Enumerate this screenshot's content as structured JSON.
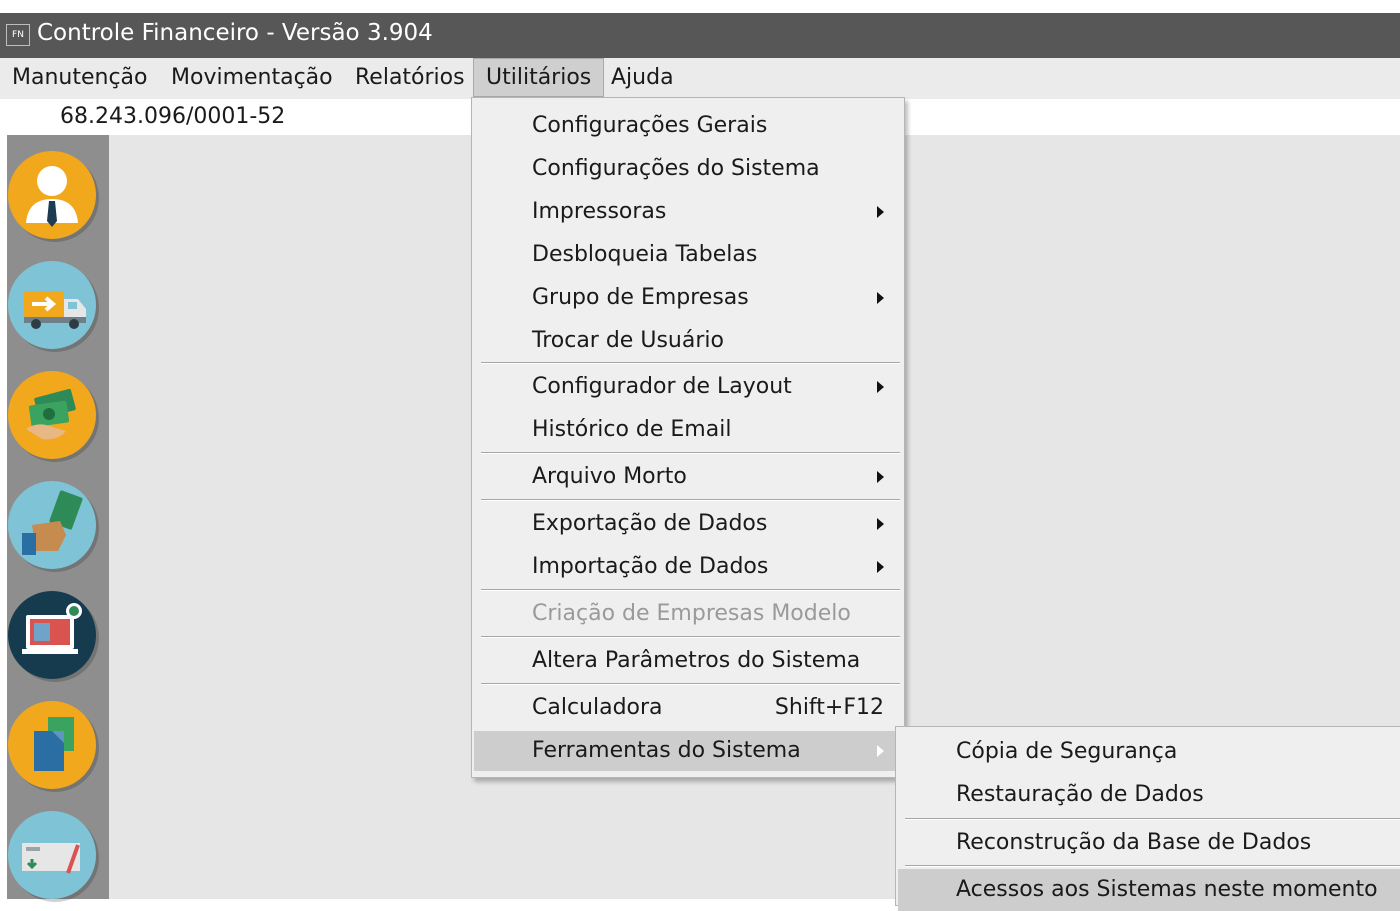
{
  "window": {
    "app_icon_text": "FN",
    "title": "Controle Financeiro - Versão 3.904"
  },
  "menubar": {
    "items": [
      {
        "label": "Manutenção"
      },
      {
        "label": "Movimentação"
      },
      {
        "label": "Relatórios"
      },
      {
        "label": "Utilitários",
        "active": true
      },
      {
        "label": "Ajuda"
      }
    ]
  },
  "company_cnpj": "68.243.096/0001-52",
  "sidebar": {
    "buttons": [
      {
        "icon": "user-icon",
        "color": "#F2A81D"
      },
      {
        "icon": "truck-icon",
        "color": "#7FC4D6"
      },
      {
        "icon": "money-icon",
        "color": "#F2A81D"
      },
      {
        "icon": "payment-hand-icon",
        "color": "#7FC4D6"
      },
      {
        "icon": "computer-icon",
        "color": "#163B4E"
      },
      {
        "icon": "documents-icon",
        "color": "#F2A81D"
      },
      {
        "icon": "bank-check-icon",
        "color": "#7FC4D6"
      }
    ]
  },
  "utilitarios_menu": {
    "items": [
      {
        "label": "Configurações Gerais"
      },
      {
        "label": "Configurações do Sistema"
      },
      {
        "label": "Impressoras",
        "submenu": true
      },
      {
        "label": "Desbloqueia Tabelas"
      },
      {
        "label": "Grupo de Empresas",
        "submenu": true
      },
      {
        "label": "Trocar de Usuário"
      },
      {
        "label": "Configurador de Layout",
        "submenu": true
      },
      {
        "label": "Histórico de Email"
      },
      {
        "label": "Arquivo Morto",
        "submenu": true
      },
      {
        "label": "Exportação de Dados",
        "submenu": true
      },
      {
        "label": "Importação de Dados",
        "submenu": true
      },
      {
        "label": "Criação de Empresas Modelo",
        "disabled": true
      },
      {
        "label": "Altera Parâmetros do Sistema"
      },
      {
        "label": "Calculadora",
        "shortcut": "Shift+F12"
      },
      {
        "label": "Ferramentas do Sistema",
        "submenu": true,
        "highlighted": true
      }
    ]
  },
  "ferramentas_submenu": {
    "items": [
      {
        "label": "Cópia de Segurança"
      },
      {
        "label": "Restauração de Dados"
      },
      {
        "label": "Reconstrução da Base de Dados"
      },
      {
        "label": "Acessos aos Sistemas neste momento",
        "highlighted": true
      }
    ]
  }
}
